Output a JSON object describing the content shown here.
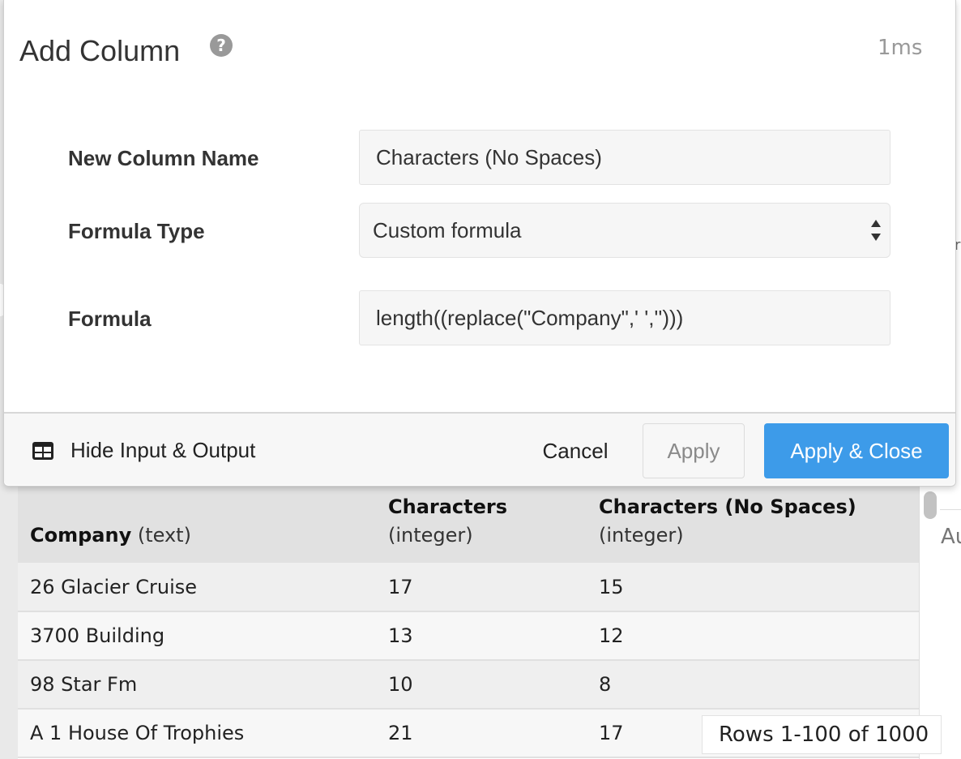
{
  "modal": {
    "title": "Add Column",
    "timing": "1ms",
    "fields": {
      "column_name_label": "New Column Name",
      "column_name_value": "Characters (No Spaces)",
      "formula_type_label": "Formula Type",
      "formula_type_value": "Custom formula",
      "formula_label": "Formula",
      "formula_value": "length((replace(\"Company\",' ','')))"
    },
    "footer": {
      "toggle_label": "Hide Input & Output",
      "cancel_label": "Cancel",
      "apply_label": "Apply",
      "apply_close_label": "Apply & Close"
    },
    "icons": {
      "help": "help-icon",
      "toggle": "table-grid-icon",
      "select_arrows": "select-arrows-icon"
    }
  },
  "table": {
    "columns": [
      {
        "name": "Company",
        "type": "(text)"
      },
      {
        "name": "Characters",
        "type": "(integer)"
      },
      {
        "name": "Characters (No Spaces)",
        "type": "(integer)"
      }
    ],
    "rows": [
      [
        "26 Glacier Cruise",
        "17",
        "15"
      ],
      [
        "3700 Building",
        "13",
        "12"
      ],
      [
        "98 Star Fm",
        "10",
        "8"
      ],
      [
        "A 1 House Of Trophies",
        "21",
        "17"
      ]
    ],
    "row_count": "Rows 1-100 of 1000"
  },
  "background": {
    "right_tab_text": "Au"
  },
  "colors": {
    "primary": "#3d9be9",
    "header_bg": "#e1e1e1",
    "field_bg": "#f6f6f6"
  }
}
